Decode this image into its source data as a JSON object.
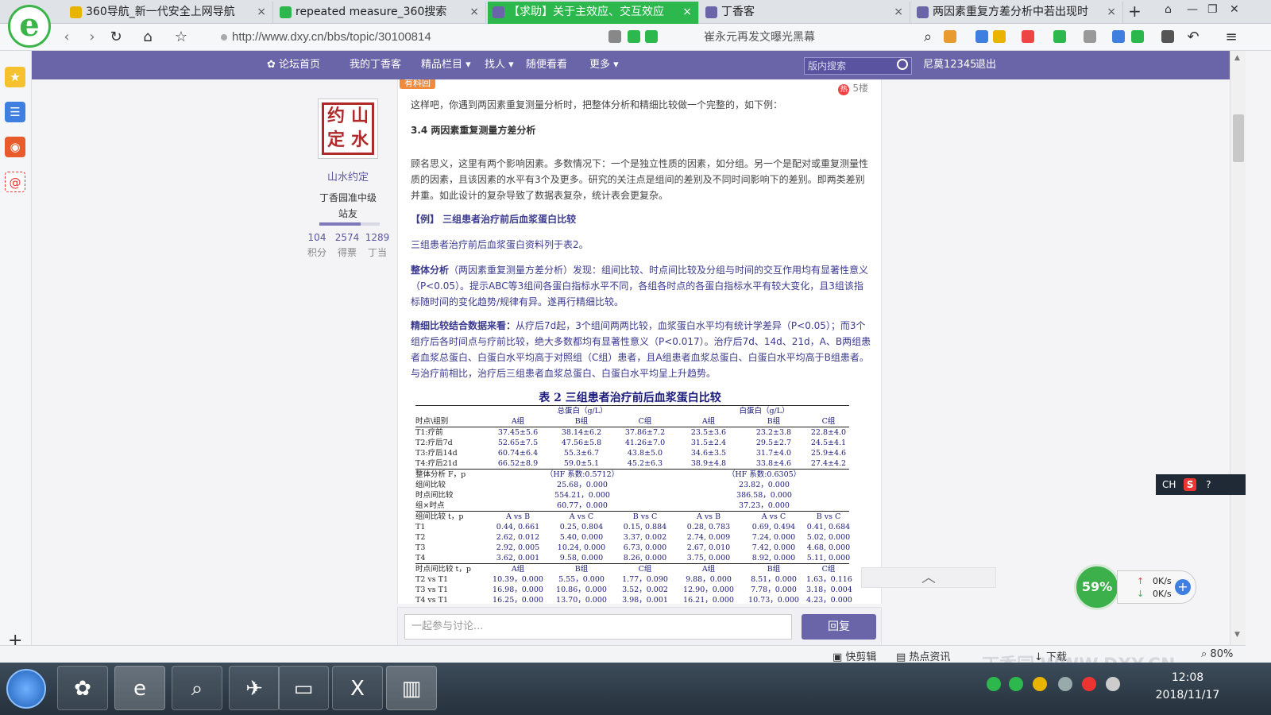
{
  "browser": {
    "tabs": [
      {
        "label": "360导航_新一代安全上网导航",
        "icon_color": "#e8b400"
      },
      {
        "label": "repeated measure_360搜索",
        "icon_color": "#2db84e"
      },
      {
        "label": "【求助】关于主效应、交互效应",
        "icon_color": "#6a64a8"
      },
      {
        "label": "丁香客",
        "icon_color": "#6a64a8"
      },
      {
        "label": "两因素重复方差分析中若出现时",
        "icon_color": "#6a64a8"
      }
    ],
    "url": "http://www.dxy.cn/bbs/topic/30100814",
    "hot_search": "崔永元再发文曝光黑幕"
  },
  "nav": {
    "items": [
      "论坛首页",
      "我的丁香客",
      "精品栏目",
      "找人",
      "随便看看",
      "更多"
    ],
    "search_placeholder": "版内搜索",
    "username": "尼莫12345",
    "logout": "退出"
  },
  "user": {
    "seal_chars": [
      "约",
      "山",
      "定",
      "水"
    ],
    "name": "山水约定",
    "level": "丁香园准中级",
    "role": "站友",
    "progress": 0.68,
    "stats": [
      {
        "num": "104",
        "label": "积分"
      },
      {
        "num": "2574",
        "label": "得票"
      },
      {
        "num": "1289",
        "label": "丁当"
      }
    ]
  },
  "post": {
    "badge": "有料回",
    "floor": "5楼",
    "hot_icon": "热",
    "p1": "这样吧，你遇到两因素重复测量分析时，把整体分析和精细比较做一个完整的，如下例：",
    "h1": "3.4 两因素重复测量方差分析",
    "p2": "顾名思义，这里有两个影响因素。多数情况下：一个是独立性质的因素，如分组。另一个是配对或重复测量性质的因素，且该因素的水平有3个及更多。研究的关注点是组间的差别及不同时间影响下的差别。即两类差别并重。如此设计的复杂导致了数据表复杂，统计表会更复杂。",
    "example_title": "【例】 三组患者治疗前后血浆蛋白比较",
    "p3": "三组患者治疗前后血浆蛋白资料列于表2。",
    "p4_bold": "整体分析",
    "p4": "（两因素重复测量方差分析）发现：组间比较、时点间比较及分组与时间的交互作用均有显著性意义（P<0.05）。提示ABC等3组间各蛋白指标水平不同，各组各时点的各蛋白指标水平有较大变化，且3组该指标随时间的变化趋势/规律有异。遂再行精细比较。",
    "p5_bold": "精细比较结合数据来看：",
    "p5": "从疗后7d起，3个组间两两比较，血浆蛋白水平均有统计学差异（P<0.05）；而3个组疗后各时间点与疗前比较，绝大多数都均有显著性意义（P<0.017）。治疗后7d、14d、21d，A、B两组患者血浆总蛋白、白蛋白水平均高于对照组（C组）患者，且A组患者血浆总蛋白、白蛋白水平均高于B组患者。与治疗前相比，治疗后三组患者血浆总蛋白、白蛋白水平均呈上升趋势。"
  },
  "table": {
    "caption": "表 2  三组患者治疗前后血浆蛋白比较",
    "group_header_1": "总蛋白（g/L）",
    "group_header_2": "白蛋白（g/L）",
    "header": [
      "时点\\组别",
      "A组",
      "B组",
      "C组",
      "A组",
      "B组",
      "C组"
    ],
    "rows1": [
      [
        "T1:疗前",
        "37.45±5.6",
        "38.14±6.2",
        "37.86±7.2",
        "23.5±3.6",
        "23.2±3.8",
        "22.8±4.0"
      ],
      [
        "T2:疗后7d",
        "52.65±7.5",
        "47.56±5.8",
        "41.26±7.0",
        "31.5±2.4",
        "29.5±2.7",
        "24.5±4.1"
      ],
      [
        "T3:疗后14d",
        "60.74±6.4",
        "55.3±6.7",
        "43.8±5.0",
        "34.6±3.5",
        "31.7±4.0",
        "25.9±4.6"
      ],
      [
        "T4:疗后21d",
        "66.52±8.9",
        "59.0±5.1",
        "45.2±6.3",
        "38.9±4.8",
        "33.8±4.6",
        "27.4±4.2"
      ]
    ],
    "overall_label": "整体分析 F，p",
    "overall_1": "（HF 系数:0.5712）",
    "overall_2": "（HF 系数:0.6305）",
    "rows2": [
      [
        "组间比较",
        "25.68，0.000",
        "23.82，0.000"
      ],
      [
        "时点间比较",
        "554.21，0.000",
        "386.58，0.000"
      ],
      [
        "组×时点",
        "60.77，0.000",
        "37.23，0.000"
      ]
    ],
    "header3": [
      "组间比较 t，p",
      "A vs B",
      "A vs C",
      "B vs C",
      "A vs B",
      "A vs C",
      "B vs C"
    ],
    "rows3": [
      [
        "T1",
        "0.44, 0.661",
        "0.25, 0.804",
        "0.15, 0.884",
        "0.28, 0.783",
        "0.69, 0.494",
        "0.41, 0.684"
      ],
      [
        "T2",
        "2.62, 0.012",
        "5.40, 0.000",
        "3.37, 0.002",
        "2.74, 0.009",
        "7.24, 0.000",
        "5.02, 0.000"
      ],
      [
        "T3",
        "2.92, 0.005",
        "10.24, 0.000",
        "6.73, 0.000",
        "2.67, 0.010",
        "7.42, 0.000",
        "4.68, 0.000"
      ],
      [
        "T4",
        "3.62, 0.001",
        "9.58, 0.000",
        "8.26, 0.000",
        "3.75, 0.000",
        "8.92, 0.000",
        "5.11, 0.000"
      ]
    ],
    "header4": [
      "时点间比较 t，p",
      "A组",
      "B组",
      "C组",
      "A组",
      "B组",
      "C组"
    ],
    "rows4": [
      [
        "T2 vs T1",
        "10.39，0.000",
        "5.55，0.000",
        "1.77，0.090",
        "9.88，0.000",
        "8.51，0.000",
        "1.63，0.116"
      ],
      [
        "T3 vs T1",
        "16.98，0.000",
        "10.86，0.000",
        "3.52，0.002",
        "12.90，0.000",
        "7.78，0.000",
        "3.18，0.004"
      ],
      [
        "T4 vs T1",
        "16.25，0.000",
        "13.70，0.000",
        "3.98，0.001",
        "16.21，0.000",
        "10.73，0.000",
        "4.23，0.000"
      ]
    ]
  },
  "reply": {
    "placeholder": "一起参与讨论...",
    "button": "回复"
  },
  "status": {
    "items": [
      "快剪辑",
      "热点资讯",
      "下载",
      "80%"
    ]
  },
  "overlay": {
    "ime_label": "CH",
    "ime_s": "S",
    "speed_percent": "59%",
    "upload": "0K/s",
    "download": "0K/s"
  },
  "taskbar": {
    "time": "12:08",
    "date": "2018/11/17"
  },
  "watermark": "丁香园 WWW.DXY.CN"
}
